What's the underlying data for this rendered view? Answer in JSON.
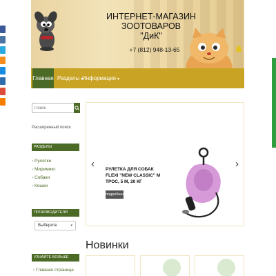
{
  "header": {
    "title_line1": "ИНТЕРНЕТ-МАГАЗИН ЗООТОВАРОВ",
    "title_line2": "\"ДиК\"",
    "phone": "+7 (812) 948-13-65"
  },
  "nav": {
    "items": [
      {
        "label": "Главная",
        "active": true
      },
      {
        "label": "Разделы",
        "dropdown": true
      },
      {
        "label": "Информация",
        "dropdown": true
      }
    ],
    "dropdown_caret": "▾"
  },
  "sidebar": {
    "search_placeholder": "Поиск",
    "advanced_search": "Расширенный поиск",
    "sections_heading": "РАЗДЕЛЫ",
    "categories": [
      "Рулетки",
      "Миримикс",
      "Собаки",
      "Кошки"
    ],
    "category_marker": "›",
    "manufacturer_heading": "ПРОИЗВОДИТЕЛИ",
    "manufacturer_select": "Выберите",
    "learn_more_heading": "УЗНАЙТЕ БОЛЬШЕ",
    "learn_more_items": [
      "Главная страница"
    ]
  },
  "slider": {
    "product_title": "РУЛЕТКА ДЛЯ СОБАК FLEXI \"NEW CLASSIC\" M ТРОС, 5 М, 20 КГ",
    "more_button": "подробнее",
    "prev_glyph": "‹",
    "next_glyph": "›"
  },
  "new_products": {
    "heading": "Новинки"
  },
  "colors": {
    "nav_bg": "#c9a323",
    "accent_green": "#4b6a25",
    "feedback_tab": "#2e9e3e",
    "leash_pink": "#d79ad9"
  },
  "icons": {
    "social": [
      "facebook-icon",
      "vk-icon",
      "twitter-icon",
      "odnoklassniki-icon",
      "mailru-icon",
      "livejournal-icon",
      "google-icon",
      "blogger-icon"
    ],
    "search": "search-icon",
    "cart": "cart-icon"
  }
}
